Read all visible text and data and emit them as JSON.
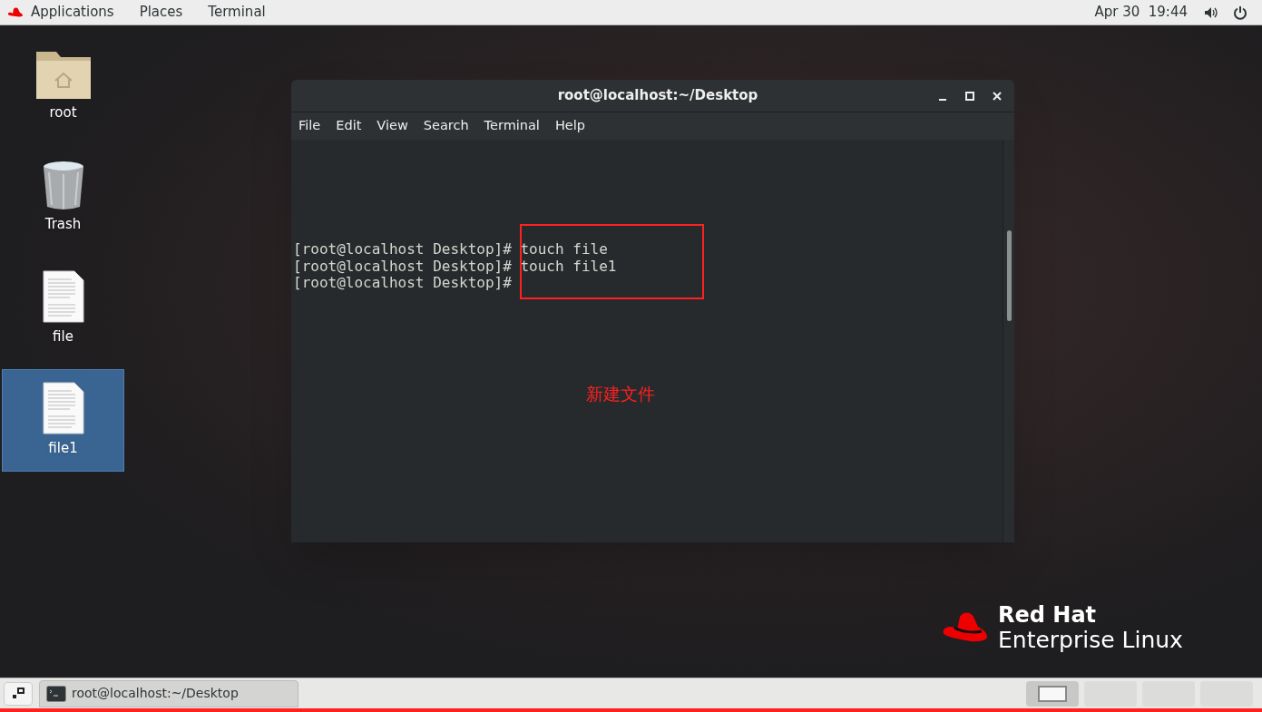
{
  "top_bar": {
    "menus": [
      "Applications",
      "Places",
      "Terminal"
    ],
    "clock": "Apr 30  19:44"
  },
  "desktop_icons": [
    {
      "label": "root",
      "kind": "folder",
      "selected": false
    },
    {
      "label": "Trash",
      "kind": "trash",
      "selected": false
    },
    {
      "label": "file",
      "kind": "file",
      "selected": false
    },
    {
      "label": "file1",
      "kind": "file",
      "selected": true
    }
  ],
  "terminal_window": {
    "title": "root@localhost:~/Desktop",
    "menu": [
      "File",
      "Edit",
      "View",
      "Search",
      "Terminal",
      "Help"
    ],
    "lines": [
      {
        "prompt": "[root@localhost Desktop]#",
        "command": "touch file"
      },
      {
        "prompt": "[root@localhost Desktop]#",
        "command": "touch file1"
      },
      {
        "prompt": "[root@localhost Desktop]#"
      }
    ]
  },
  "annotation": "新建文件",
  "logo": {
    "brand": "Red Hat",
    "product": "Enterprise Linux"
  },
  "taskbar": {
    "window_button": "root@localhost:~/Desktop",
    "workspaces": [
      {
        "selected": true
      },
      {
        "selected": false
      },
      {
        "selected": false
      },
      {
        "selected": false
      }
    ]
  }
}
